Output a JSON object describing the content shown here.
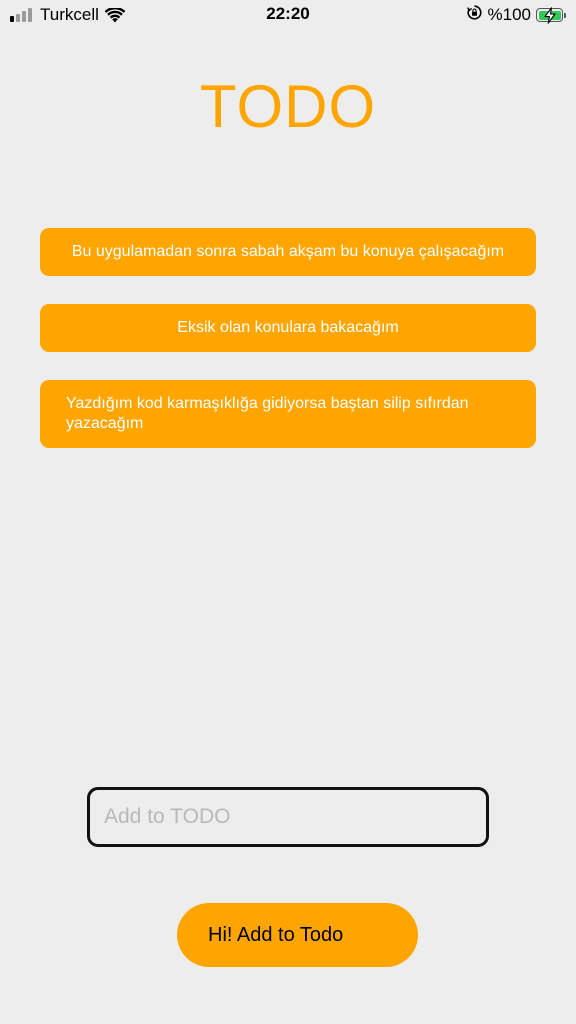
{
  "status_bar": {
    "carrier": "Turkcell",
    "time": "22:20",
    "battery_percent": "%100",
    "signal_bars_active": 1,
    "signal_bars_total": 4
  },
  "app": {
    "title": "TODO"
  },
  "todos": [
    {
      "text": "Bu uygulamadan sonra sabah akşam bu konuya çalışacağım"
    },
    {
      "text": "Eksik olan konulara bakacağım"
    },
    {
      "text": "Yazdığım kod karmaşıklığa gidiyorsa baştan silip sıfırdan yazacağım"
    }
  ],
  "input": {
    "value": "",
    "placeholder": "Add to TODO"
  },
  "add_button": {
    "label": "Hi! Add to Todo"
  },
  "colors": {
    "accent": "#FFA500",
    "background": "#EEEDED",
    "battery": "#35C759"
  },
  "icons": [
    "cellular-signal-icon",
    "wifi-icon",
    "orientation-lock-icon",
    "battery-icon",
    "charging-bolt-icon"
  ]
}
